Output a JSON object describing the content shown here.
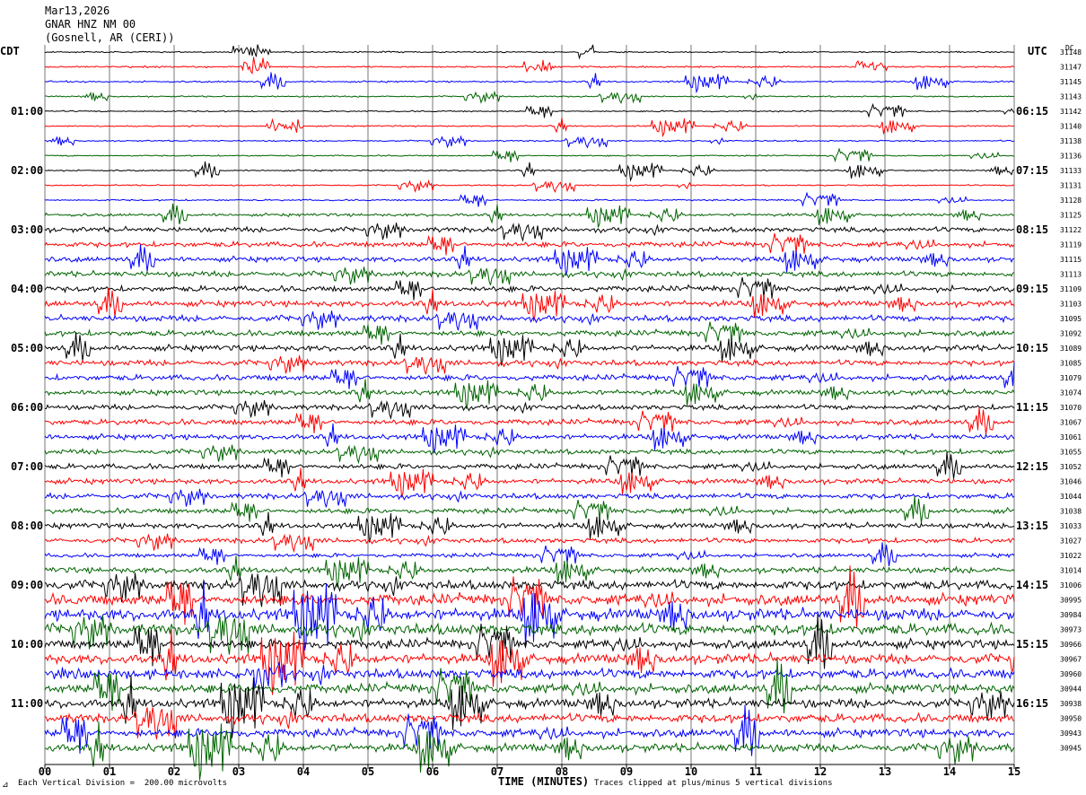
{
  "header": {
    "date": "Mar13,2026",
    "station": "GNAR HNZ NM 00",
    "location": "(Gosnell, AR (CERI))"
  },
  "left_tz": "CDT",
  "right_tz": "UTC",
  "dc_label": "DC",
  "footer": {
    "scale_note": "Each Vertical Division =  200.00 microvolts",
    "clip_note": "Traces clipped at plus/minus 5 vertical divisions",
    "corner_mark": "⊿"
  },
  "colors": [
    "#000000",
    "#ff0000",
    "#0000ff",
    "#006400"
  ],
  "chart_data": {
    "type": "line",
    "xlabel": "TIME (MINUTES)",
    "xlim": [
      0,
      15
    ],
    "x_ticks": [
      "00",
      "01",
      "02",
      "03",
      "04",
      "05",
      "06",
      "07",
      "08",
      "09",
      "10",
      "11",
      "12",
      "13",
      "14",
      "15"
    ],
    "left_hour_labels": [
      "01:00",
      "02:00",
      "03:00",
      "04:00",
      "05:00",
      "06:00",
      "07:00",
      "08:00",
      "09:00",
      "10:00",
      "11:00"
    ],
    "right_hour_labels": [
      "06:15",
      "07:15",
      "08:15",
      "09:15",
      "10:15",
      "11:15",
      "12:15",
      "13:15",
      "14:15",
      "15:15",
      "16:15"
    ],
    "dc_offsets": [
      31148,
      31147,
      31145,
      31143,
      31142,
      31140,
      31138,
      31136,
      31133,
      31131,
      31128,
      31125,
      31122,
      31119,
      31115,
      31113,
      31109,
      31103,
      31095,
      31092,
      31089,
      31085,
      31079,
      31074,
      31070,
      31067,
      31061,
      31055,
      31052,
      31046,
      31044,
      31038,
      31033,
      31027,
      31022,
      31014,
      31006,
      30995,
      30984,
      30973,
      30966,
      30967,
      30960,
      30944,
      30938,
      30950,
      30943,
      30945
    ],
    "trace_amplitude_level": [
      0.6,
      0.7,
      0.7,
      0.6,
      0.6,
      0.6,
      0.6,
      0.6,
      0.6,
      0.6,
      0.7,
      1.3,
      2.2,
      2.3,
      2.3,
      2.4,
      2.5,
      2.6,
      2.7,
      2.5,
      2.6,
      2.5,
      2.5,
      2.3,
      2.3,
      2.4,
      2.3,
      2.2,
      2.3,
      2.3,
      2.4,
      2.3,
      2.4,
      2.2,
      1.8,
      2.6,
      4.0,
      4.8,
      5.2,
      4.9,
      4.0,
      4.3,
      4.2,
      4.0,
      4.0,
      3.8,
      3.6,
      3.6
    ]
  }
}
